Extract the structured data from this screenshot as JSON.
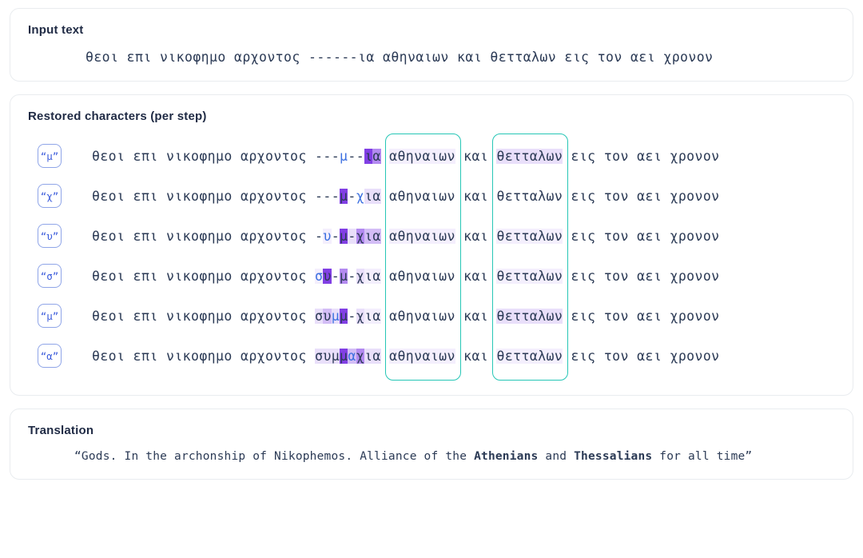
{
  "input_card": {
    "title": "Input text",
    "text": "θεοι επι νικοφημο αρχοντος ------ια αθηναιων και θετταλων εις τον αει χρονον"
  },
  "steps_card": {
    "title": "Restored characters (per step)",
    "prefix": "θεοι επι νικοφημο αρχοντος ",
    "word_athenians": "αθηναιων",
    "word_kai": "και",
    "word_thessalians": "θετταλων",
    "suffix": "εις τον αει χρονον",
    "highlight_boxes": [
      {
        "name": "athenians-box",
        "label": "αθηναιων"
      },
      {
        "name": "thessalians-box",
        "label": "θετταλων"
      }
    ],
    "steps": [
      {
        "badge": "“μ”",
        "restored": "---μ--ια",
        "chars": [
          {
            "c": "-",
            "lvl": 0,
            "new": false
          },
          {
            "c": "-",
            "lvl": 0,
            "new": false
          },
          {
            "c": "-",
            "lvl": 0,
            "new": false
          },
          {
            "c": "μ",
            "lvl": 0,
            "new": true
          },
          {
            "c": "-",
            "lvl": 0,
            "new": false
          },
          {
            "c": "-",
            "lvl": 0,
            "new": false
          },
          {
            "c": "ι",
            "lvl": 5,
            "new": false
          },
          {
            "c": "α",
            "lvl": 4,
            "new": false
          }
        ],
        "athenians_lvl": 1,
        "thessalians_lvl": 2
      },
      {
        "badge": "“χ”",
        "restored": "---μ-χια",
        "chars": [
          {
            "c": "-",
            "lvl": 0,
            "new": false
          },
          {
            "c": "-",
            "lvl": 0,
            "new": false
          },
          {
            "c": "-",
            "lvl": 0,
            "new": false
          },
          {
            "c": "μ",
            "lvl": 5,
            "new": false
          },
          {
            "c": "-",
            "lvl": 0,
            "new": false
          },
          {
            "c": "χ",
            "lvl": 0,
            "new": true
          },
          {
            "c": "ι",
            "lvl": 2,
            "new": false
          },
          {
            "c": "α",
            "lvl": 2,
            "new": false
          }
        ],
        "athenians_lvl": 0,
        "thessalians_lvl": 0
      },
      {
        "badge": "“υ”",
        "restored": "-υ-μ-χια",
        "chars": [
          {
            "c": "-",
            "lvl": 0,
            "new": false
          },
          {
            "c": "υ",
            "lvl": 1,
            "new": true
          },
          {
            "c": "-",
            "lvl": 0,
            "new": false
          },
          {
            "c": "μ",
            "lvl": 5,
            "new": false
          },
          {
            "c": "-",
            "lvl": 2,
            "new": false
          },
          {
            "c": "χ",
            "lvl": 4,
            "new": false
          },
          {
            "c": "ι",
            "lvl": 3,
            "new": false
          },
          {
            "c": "α",
            "lvl": 3,
            "new": false
          }
        ],
        "athenians_lvl": 1,
        "thessalians_lvl": 1
      },
      {
        "badge": "“σ”",
        "restored": "συ-μ-χια",
        "chars": [
          {
            "c": "σ",
            "lvl": 1,
            "new": true
          },
          {
            "c": "υ",
            "lvl": 5,
            "new": false
          },
          {
            "c": "-",
            "lvl": 0,
            "new": false
          },
          {
            "c": "μ",
            "lvl": 4,
            "new": false
          },
          {
            "c": "-",
            "lvl": 0,
            "new": false
          },
          {
            "c": "χ",
            "lvl": 2,
            "new": false
          },
          {
            "c": "ι",
            "lvl": 1,
            "new": false
          },
          {
            "c": "α",
            "lvl": 1,
            "new": false
          }
        ],
        "athenians_lvl": 0,
        "thessalians_lvl": 1
      },
      {
        "badge": "“μ”",
        "restored": "συμμ-χια",
        "chars": [
          {
            "c": "σ",
            "lvl": 2,
            "new": false
          },
          {
            "c": "υ",
            "lvl": 3,
            "new": false
          },
          {
            "c": "μ",
            "lvl": 2,
            "new": true
          },
          {
            "c": "μ",
            "lvl": 5,
            "new": false
          },
          {
            "c": "-",
            "lvl": 0,
            "new": false
          },
          {
            "c": "χ",
            "lvl": 2,
            "new": false
          },
          {
            "c": "ι",
            "lvl": 1,
            "new": false
          },
          {
            "c": "α",
            "lvl": 1,
            "new": false
          }
        ],
        "athenians_lvl": 0,
        "thessalians_lvl": 2
      },
      {
        "badge": "“α”",
        "restored": "συμμαχια",
        "chars": [
          {
            "c": "σ",
            "lvl": 2,
            "new": false
          },
          {
            "c": "υ",
            "lvl": 2,
            "new": false
          },
          {
            "c": "μ",
            "lvl": 2,
            "new": false
          },
          {
            "c": "μ",
            "lvl": 5,
            "new": false
          },
          {
            "c": "α",
            "lvl": 3,
            "new": true
          },
          {
            "c": "χ",
            "lvl": 4,
            "new": false
          },
          {
            "c": "ι",
            "lvl": 2,
            "new": false
          },
          {
            "c": "α",
            "lvl": 2,
            "new": false
          }
        ],
        "athenians_lvl": 1,
        "thessalians_lvl": 1
      }
    ]
  },
  "translation_card": {
    "title": "Translation",
    "segments": [
      {
        "text": "“Gods. In the archonship of Nikophemos. Alliance of the ",
        "bold": false
      },
      {
        "text": "Athenians",
        "bold": true
      },
      {
        "text": " and ",
        "bold": false
      },
      {
        "text": "Thessalians",
        "bold": true
      },
      {
        "text": " for all time”",
        "bold": false
      }
    ]
  },
  "colors": {
    "accent_purple": "#7024e0",
    "accent_blue": "#3b6fe0",
    "box_teal": "#26c6b6",
    "text": "#2b3a55",
    "card_border": "#e9ecef"
  }
}
